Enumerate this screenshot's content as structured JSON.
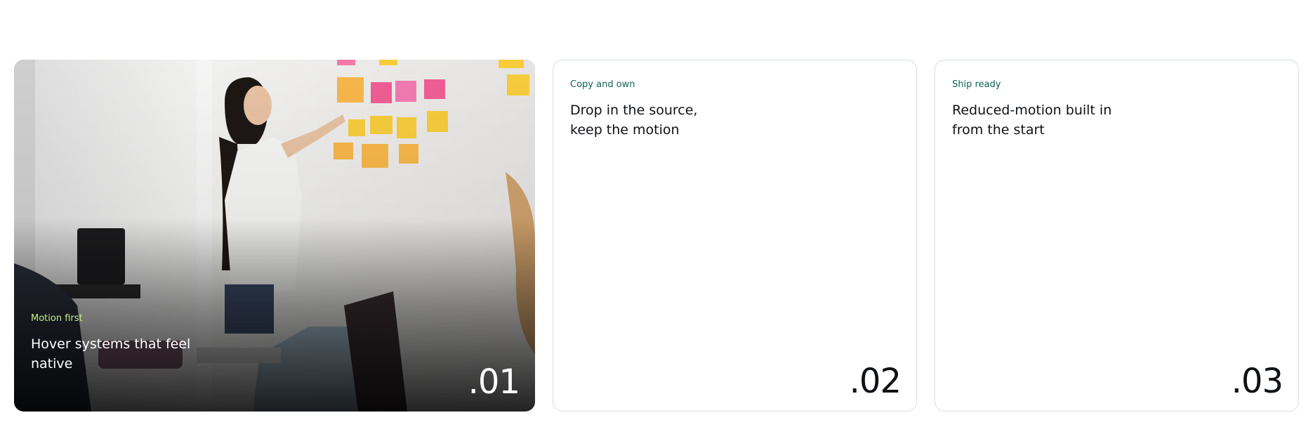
{
  "cards": [
    {
      "eyebrow": "Motion first",
      "title": "Hover systems that feel native",
      "index": ".01"
    },
    {
      "eyebrow": "Copy and own",
      "title": "Drop in the source, keep the motion",
      "index": ".02"
    },
    {
      "eyebrow": "Ship ready",
      "title": "Reduced-motion built in from the start",
      "index": ".03"
    }
  ],
  "colors": {
    "eyebrow_light": "#c6f08a",
    "eyebrow_dark": "#12624f",
    "heading": "#0f1115",
    "card_border": "#d9dee0"
  }
}
